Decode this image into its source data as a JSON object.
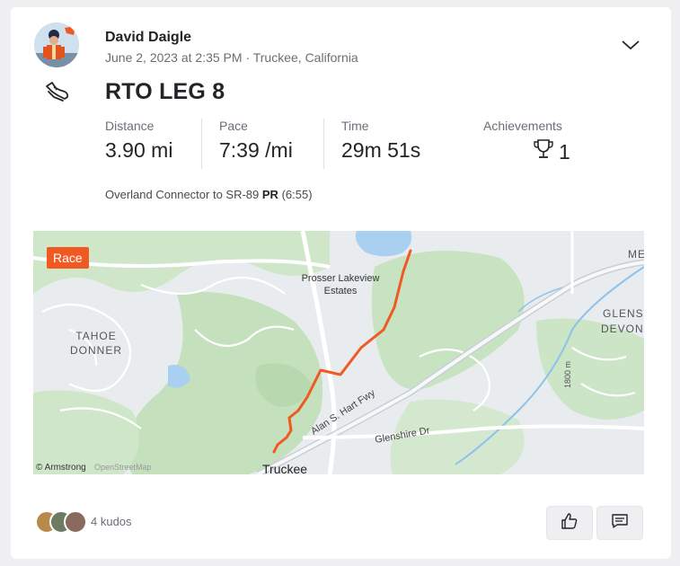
{
  "athlete": {
    "name": "David Daigle"
  },
  "activity": {
    "meta": "June 2, 2023 at 2:35 PM · Truckee, California",
    "title": "RTO LEG 8",
    "sport": "run"
  },
  "stats": {
    "distance": {
      "label": "Distance",
      "value": "3.90 mi"
    },
    "pace": {
      "label": "Pace",
      "value": "7:39 /mi"
    },
    "time": {
      "label": "Time",
      "value": "29m 51s"
    },
    "achievements": {
      "label": "Achievements",
      "value": "1"
    }
  },
  "segment": {
    "name": "Overland Connector to SR-89",
    "pr_label": "PR",
    "pr_time": "(6:55)"
  },
  "map": {
    "badge": "Race",
    "route_color": "#f05a22",
    "labels": {
      "prosser_1": "Prosser Lakeview",
      "prosser_2": "Estates",
      "tahoe": "TAHOE",
      "donner": "DONNER",
      "glens": "GLENS",
      "devon": "DEVON",
      "me": "ME",
      "road1": "Alan S. Hart Fwy",
      "road2": "Glenshire Dr",
      "road3": "1800 m",
      "truckee": "Truckee",
      "attribution": "© Armstrong",
      "osm": "OpenStreetMap"
    }
  },
  "kudos": {
    "text": "4 kudos"
  },
  "colors": {
    "accent": "#f05a22",
    "text": "#242428",
    "muted": "#6d6d78"
  }
}
